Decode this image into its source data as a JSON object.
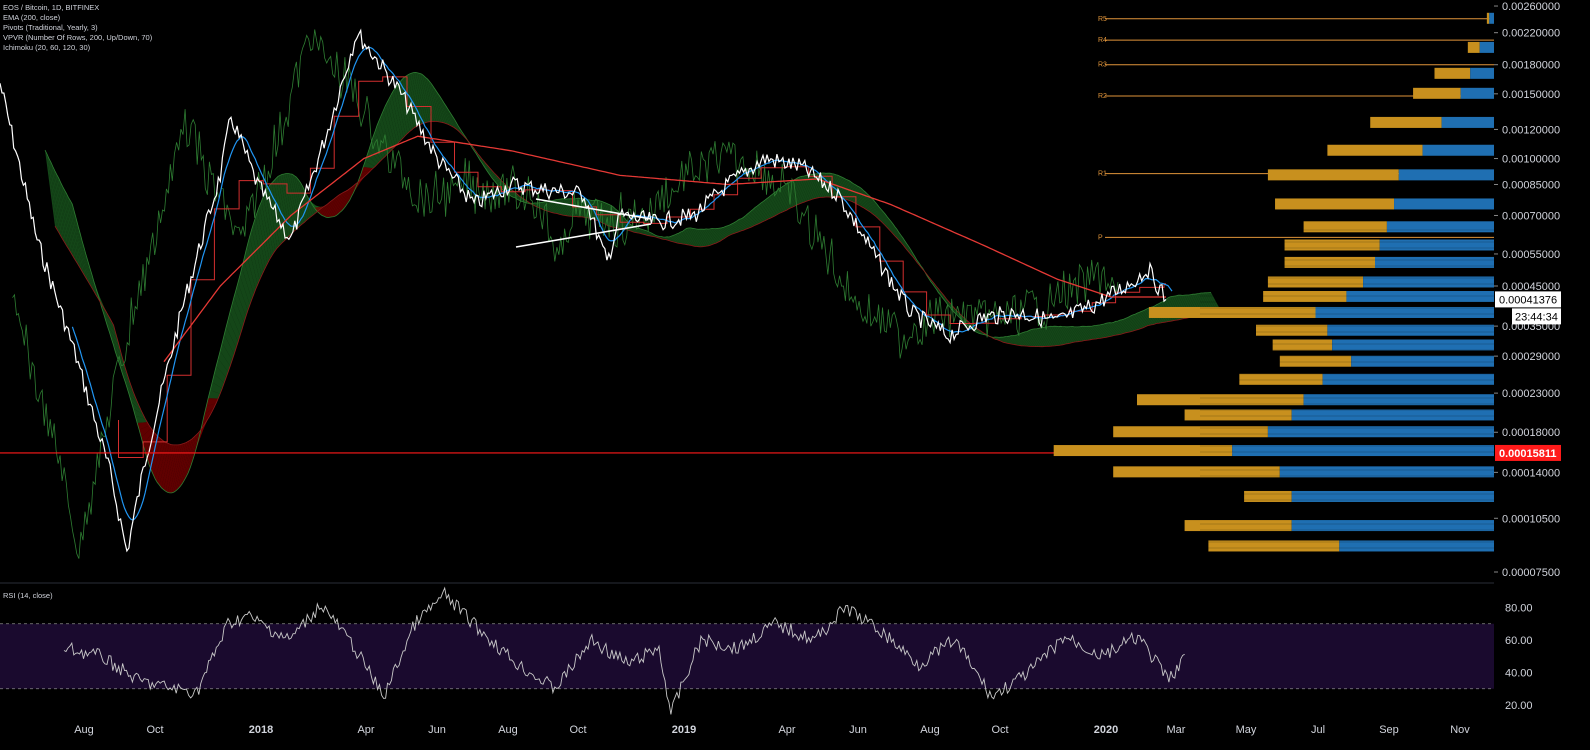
{
  "header": {
    "symbol_line": "EOS / Bitcoin, 1D, BITFINEX",
    "indicators": [
      "EMA (200, close)",
      "Pivots (Traditional, Yearly, 3)",
      "VPVR (Number Of Rows, 200, Up/Down, 70)",
      "Ichimoku (20, 60, 120, 30)"
    ],
    "rsi_title": "RSI (14, close)"
  },
  "colors": {
    "background": "#000000",
    "price": "#ffffff",
    "conversion": "#2196f3",
    "base": "#d32f2f",
    "ema": "#e53935",
    "lagging": "#2e7d32",
    "cloud_bull": "#1b5e20",
    "cloud_bear": "#7f0000",
    "pivot": "#e0943a",
    "vpvr_up": "#1f6fb2",
    "vpvr_down": "#c8901e",
    "rsi": "#c8c8c8",
    "rsi_band": "#1a0a2e",
    "hline": "#ff1a1a"
  },
  "price_axis": {
    "ticks": [
      "0.00260000",
      "0.00220000",
      "0.00180000",
      "0.00150000",
      "0.00120000",
      "0.00100000",
      "0.00085000",
      "0.00070000",
      "0.00055000",
      "0.00045000",
      "0.00035000",
      "0.00029000",
      "0.00023000",
      "0.00018000",
      "0.00014000",
      "0.00010500",
      "0.00007500"
    ],
    "current_price_label": "0.00041376",
    "countdown_label": "23:44:34",
    "hline_label": "0.00015811"
  },
  "rsi_axis": {
    "ticks": [
      "80.00",
      "60.00",
      "40.00",
      "20.00"
    ]
  },
  "time_axis": {
    "ticks": [
      "Aug",
      "Oct",
      "2018",
      "Apr",
      "Jun",
      "Aug",
      "Oct",
      "2019",
      "Apr",
      "Jun",
      "Aug",
      "Oct",
      "2020",
      "Mar",
      "May",
      "Jul",
      "Sep",
      "Nov"
    ]
  },
  "pivots": [
    {
      "label": "R5",
      "value": 0.0024
    },
    {
      "label": "R4",
      "value": 0.0021
    },
    {
      "label": "R3",
      "value": 0.0018
    },
    {
      "label": "R2",
      "value": 0.00148
    },
    {
      "label": "R1",
      "value": 0.00091
    },
    {
      "label": "P",
      "value": 0.00061
    }
  ],
  "chart_data": {
    "type": "line",
    "title": "EOS / Bitcoin, 1D, BITFINEX",
    "y_scale": "log",
    "ylim": [
      7e-05,
      0.0027
    ],
    "xlim": [
      "2017-07-01",
      "2020-11-30"
    ],
    "series": [
      {
        "name": "EOS / Bitcoin",
        "x": [
          "2017-07-01",
          "2017-08-01",
          "2017-09-01",
          "2017-10-01",
          "2017-10-15",
          "2017-11-01",
          "2017-12-01",
          "2018-01-01",
          "2018-01-10",
          "2018-02-01",
          "2018-03-01",
          "2018-04-01",
          "2018-04-25",
          "2018-05-15",
          "2018-06-01",
          "2018-07-01",
          "2018-08-01",
          "2018-09-01",
          "2018-10-01",
          "2018-11-01",
          "2018-11-20",
          "2018-12-01",
          "2019-01-01",
          "2019-02-01",
          "2019-03-01",
          "2019-04-01",
          "2019-05-01",
          "2019-06-01",
          "2019-07-01",
          "2019-08-01",
          "2019-09-01",
          "2019-10-01",
          "2019-11-01",
          "2019-12-01",
          "2020-01-01",
          "2020-02-01",
          "2020-02-15",
          "2020-03-01"
        ],
        "values": [
          0.0016,
          0.0006,
          0.0003,
          0.00014,
          8.5e-05,
          0.00016,
          0.0004,
          0.0009,
          0.0013,
          0.00085,
          0.0006,
          0.0012,
          0.0022,
          0.0018,
          0.0015,
          0.001,
          0.00075,
          0.00085,
          0.00082,
          0.0008,
          0.00052,
          0.0007,
          0.00067,
          0.0007,
          0.00085,
          0.001,
          0.00095,
          0.0008,
          0.00055,
          0.00038,
          0.00033,
          0.00037,
          0.00038,
          0.00036,
          0.0004,
          0.00046,
          0.0005,
          0.00041376
        ]
      },
      {
        "name": "EMA (200, close)",
        "x": [
          "2017-11-15",
          "2018-01-01",
          "2018-03-01",
          "2018-05-01",
          "2018-06-15",
          "2018-09-01",
          "2018-12-01",
          "2019-03-01",
          "2019-05-15",
          "2019-07-15",
          "2019-10-01",
          "2019-12-01",
          "2020-01-15",
          "2020-03-01"
        ],
        "values": [
          0.00028,
          0.00045,
          0.0007,
          0.001,
          0.00115,
          0.00105,
          0.0009,
          0.00085,
          0.00088,
          0.00075,
          0.00058,
          0.00047,
          0.00042,
          0.00042
        ]
      }
    ],
    "rsi": {
      "name": "RSI (14, close)",
      "ylim": [
        12,
        92
      ],
      "bands": [
        70,
        30
      ],
      "x": [
        "2017-07-01",
        "2017-08-01",
        "2017-09-01",
        "2017-10-01",
        "2017-10-20",
        "2017-11-15",
        "2017-12-01",
        "2018-01-05",
        "2018-02-01",
        "2018-03-01",
        "2018-03-25",
        "2018-04-20",
        "2018-05-15",
        "2018-06-15",
        "2018-07-15",
        "2018-08-15",
        "2018-09-15",
        "2018-10-15",
        "2018-11-10",
        "2018-11-20",
        "2018-12-15",
        "2019-01-15",
        "2019-02-15",
        "2019-03-20",
        "2019-04-15",
        "2019-05-15",
        "2019-06-15",
        "2019-07-15",
        "2019-08-15",
        "2019-09-15",
        "2019-10-15",
        "2019-11-15",
        "2019-12-15",
        "2020-01-10",
        "2020-02-10",
        "2020-02-18",
        "2020-03-01"
      ],
      "values": [
        55,
        50,
        35,
        30,
        28,
        70,
        75,
        60,
        82,
        55,
        25,
        70,
        88,
        65,
        45,
        30,
        60,
        45,
        55,
        15,
        60,
        55,
        70,
        60,
        80,
        65,
        45,
        60,
        25,
        40,
        62,
        50,
        62,
        35,
        72,
        78,
        42
      ]
    },
    "vpvr": {
      "name": "VPVR (Number Of Rows, 200, Up/Down, 70)",
      "levels": [
        0.0024,
        0.002,
        0.0017,
        0.0015,
        0.00125,
        0.00105,
        0.0009,
        0.00075,
        0.00065,
        0.00058,
        0.00052,
        0.00046,
        0.00042,
        0.00038,
        0.00034,
        0.00031,
        0.00028,
        0.00025,
        0.00022,
        0.0002,
        0.00018,
        0.00016,
        0.00014,
        0.00012,
        0.0001,
        8.8e-05
      ],
      "up": [
        0.02,
        0.06,
        0.1,
        0.14,
        0.22,
        0.3,
        0.4,
        0.42,
        0.45,
        0.48,
        0.5,
        0.55,
        0.62,
        0.75,
        0.7,
        0.68,
        0.6,
        0.72,
        0.8,
        0.85,
        0.95,
        1.1,
        0.9,
        0.85,
        0.85,
        0.65
      ],
      "down": [
        0.01,
        0.05,
        0.15,
        0.2,
        0.3,
        0.4,
        0.55,
        0.5,
        0.35,
        0.4,
        0.38,
        0.4,
        0.35,
        0.7,
        0.3,
        0.25,
        0.3,
        0.35,
        0.7,
        0.45,
        0.65,
        0.75,
        0.7,
        0.2,
        0.45,
        0.55
      ]
    }
  }
}
